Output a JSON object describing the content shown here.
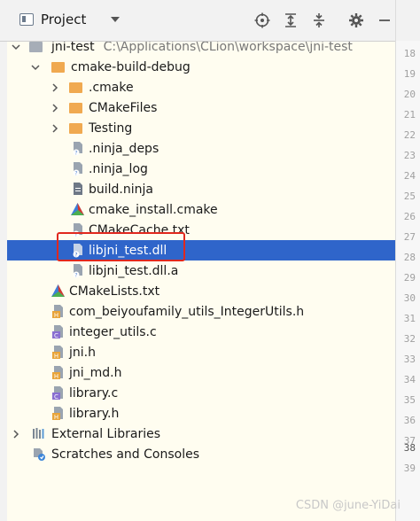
{
  "header": {
    "title": "Project"
  },
  "tree": {
    "root": {
      "label": "jni-test",
      "path": "C:\\Applications\\CLion\\workspace\\jni-test"
    },
    "build_dir": {
      "label": "cmake-build-debug"
    },
    "build_children": [
      {
        "label": ".cmake"
      },
      {
        "label": "CMakeFiles"
      },
      {
        "label": "Testing"
      },
      {
        "label": ".ninja_deps"
      },
      {
        "label": ".ninja_log"
      },
      {
        "label": "build.ninja"
      },
      {
        "label": "cmake_install.cmake"
      },
      {
        "label": "CMakeCache.txt"
      },
      {
        "label": "libjni_test.dll"
      },
      {
        "label": "libjni_test.dll.a"
      }
    ],
    "root_children": [
      {
        "label": "CMakeLists.txt"
      },
      {
        "label": "com_beiyoufamily_utils_IntegerUtils.h"
      },
      {
        "label": "integer_utils.c"
      },
      {
        "label": "jni.h"
      },
      {
        "label": "jni_md.h"
      },
      {
        "label": "library.c"
      },
      {
        "label": "library.h"
      }
    ],
    "external": {
      "label": "External Libraries"
    },
    "scratches": {
      "label": "Scratches and Consoles"
    }
  },
  "gutter": {
    "lines": [
      "18",
      "19",
      "20",
      "21",
      "22",
      "23",
      "24",
      "25",
      "26",
      "27",
      "28",
      "29",
      "30",
      "31",
      "32",
      "33",
      "34",
      "35",
      "36",
      "37",
      "38",
      "39"
    ],
    "highlight": "38"
  },
  "watermark": "CSDN @june-YiDai",
  "colors": {
    "selection": "#2f65ca",
    "folder": "#f0a950",
    "highlight_box": "#e0281e"
  }
}
